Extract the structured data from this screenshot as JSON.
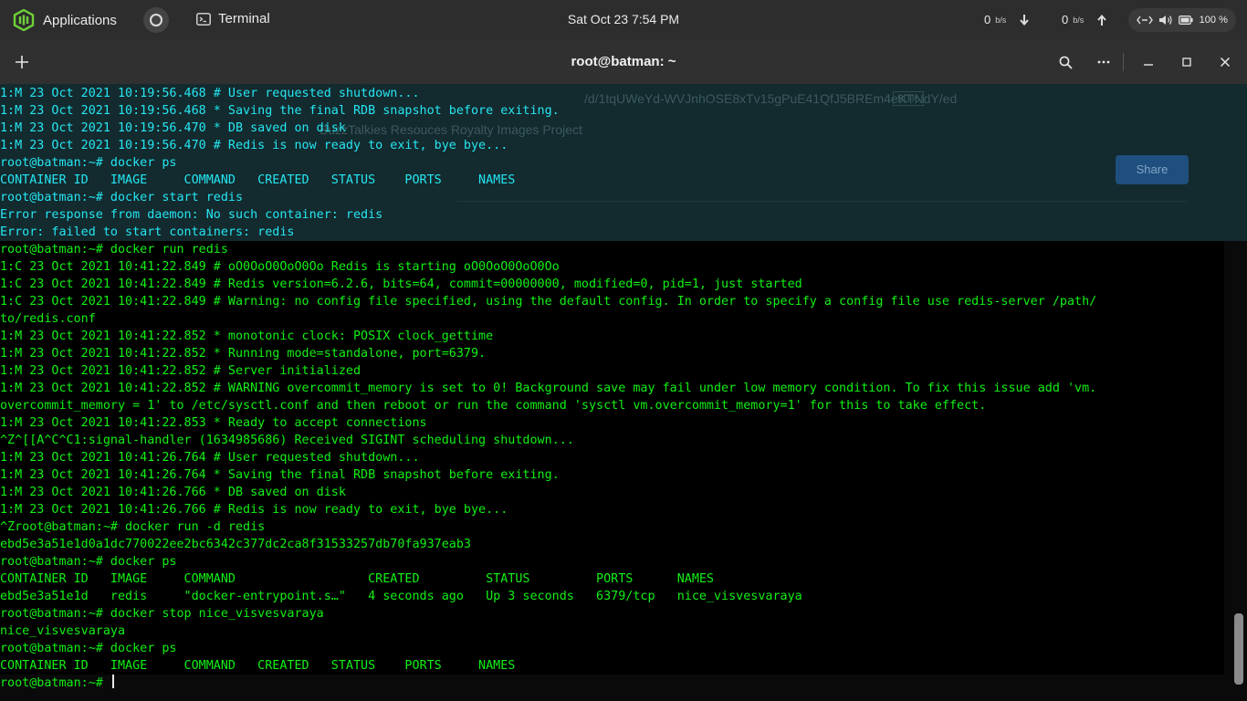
{
  "topbar": {
    "applications_label": "Applications",
    "terminal_task_label": "Terminal",
    "clock": "Sat Oct 23   7:54 PM",
    "net_down_value": "0",
    "net_down_unit": "b/s",
    "net_up_value": "0",
    "net_up_unit": "b/s",
    "battery_percent": "100 %"
  },
  "window": {
    "title": "root@batman: ~"
  },
  "background_browser": {
    "url_fragment": "/d/1tqUWeYd-WVJnhOSE8xTv15gPuE41QfJ5BREm4eKTNdY/ed",
    "zoom": "90%",
    "bookmarks": "BuzzTalkies Resouces   Royalty Images   Project",
    "share_label": "Share"
  },
  "terminal": {
    "lines": [
      {
        "text": "1:M 23 Oct 2021 10:19:56.468 # User requested shutdown...",
        "old": true
      },
      {
        "text": "1:M 23 Oct 2021 10:19:56.468 * Saving the final RDB snapshot before exiting.",
        "old": true
      },
      {
        "text": "1:M 23 Oct 2021 10:19:56.470 * DB saved on disk",
        "old": true
      },
      {
        "text": "1:M 23 Oct 2021 10:19:56.470 # Redis is now ready to exit, bye bye...",
        "old": true
      },
      {
        "text": "root@batman:~# docker ps",
        "old": true
      },
      {
        "text": "CONTAINER ID   IMAGE     COMMAND   CREATED   STATUS    PORTS     NAMES",
        "old": true
      },
      {
        "text": "root@batman:~# docker start redis",
        "old": true
      },
      {
        "text": "Error response from daemon: No such container: redis",
        "old": true
      },
      {
        "text": "Error: failed to start containers: redis",
        "old": true
      },
      {
        "text": "root@batman:~# docker run redis",
        "old": false
      },
      {
        "text": "1:C 23 Oct 2021 10:41:22.849 # oO0OoO0OoO0Oo Redis is starting oO0OoO0OoO0Oo",
        "old": false
      },
      {
        "text": "1:C 23 Oct 2021 10:41:22.849 # Redis version=6.2.6, bits=64, commit=00000000, modified=0, pid=1, just started",
        "old": false
      },
      {
        "text": "1:C 23 Oct 2021 10:41:22.849 # Warning: no config file specified, using the default config. In order to specify a config file use redis-server /path/",
        "old": false
      },
      {
        "text": "to/redis.conf",
        "old": false
      },
      {
        "text": "1:M 23 Oct 2021 10:41:22.852 * monotonic clock: POSIX clock_gettime",
        "old": false
      },
      {
        "text": "1:M 23 Oct 2021 10:41:22.852 * Running mode=standalone, port=6379.",
        "old": false
      },
      {
        "text": "1:M 23 Oct 2021 10:41:22.852 # Server initialized",
        "old": false
      },
      {
        "text": "1:M 23 Oct 2021 10:41:22.852 # WARNING overcommit_memory is set to 0! Background save may fail under low memory condition. To fix this issue add 'vm.",
        "old": false
      },
      {
        "text": "overcommit_memory = 1' to /etc/sysctl.conf and then reboot or run the command 'sysctl vm.overcommit_memory=1' for this to take effect.",
        "old": false
      },
      {
        "text": "1:M 23 Oct 2021 10:41:22.853 * Ready to accept connections",
        "old": false
      },
      {
        "text": "^Z^[[A^C^C1:signal-handler (1634985686) Received SIGINT scheduling shutdown...",
        "old": false
      },
      {
        "text": "1:M 23 Oct 2021 10:41:26.764 # User requested shutdown...",
        "old": false
      },
      {
        "text": "1:M 23 Oct 2021 10:41:26.764 * Saving the final RDB snapshot before exiting.",
        "old": false
      },
      {
        "text": "1:M 23 Oct 2021 10:41:26.766 * DB saved on disk",
        "old": false
      },
      {
        "text": "1:M 23 Oct 2021 10:41:26.766 # Redis is now ready to exit, bye bye...",
        "old": false
      },
      {
        "text": "^Zroot@batman:~# docker run -d redis",
        "old": false
      },
      {
        "text": "ebd5e3a51e1d0a1dc770022ee2bc6342c377dc2ca8f31533257db70fa937eab3",
        "old": false
      },
      {
        "text": "root@batman:~# docker ps",
        "old": false
      },
      {
        "text": "CONTAINER ID   IMAGE     COMMAND                  CREATED         STATUS         PORTS      NAMES",
        "old": false
      },
      {
        "text": "ebd5e3a51e1d   redis     \"docker-entrypoint.s…\"   4 seconds ago   Up 3 seconds   6379/tcp   nice_visvesvaraya",
        "old": false
      },
      {
        "text": "root@batman:~# docker stop nice_visvesvaraya",
        "old": false
      },
      {
        "text": "nice_visvesvaraya",
        "old": false
      },
      {
        "text": "root@batman:~# docker ps",
        "old": false
      },
      {
        "text": "CONTAINER ID   IMAGE     COMMAND   CREATED   STATUS    PORTS     NAMES",
        "old": false
      }
    ],
    "prompt": "root@batman:~# "
  },
  "colors": {
    "output_text": "#12f015",
    "older_text": "#25e6f2",
    "terminal_bg": "#000000",
    "header_bg": "#303030",
    "topbar_bg": "#2d2d2d"
  },
  "icons": [
    "app-logo-icon",
    "terminal-icon",
    "download-arrow-icon",
    "upload-arrow-icon",
    "network-icon",
    "volume-icon",
    "battery-icon",
    "new-tab-icon",
    "search-icon",
    "menu-dots-icon",
    "minimize-icon",
    "maximize-icon",
    "close-icon"
  ]
}
